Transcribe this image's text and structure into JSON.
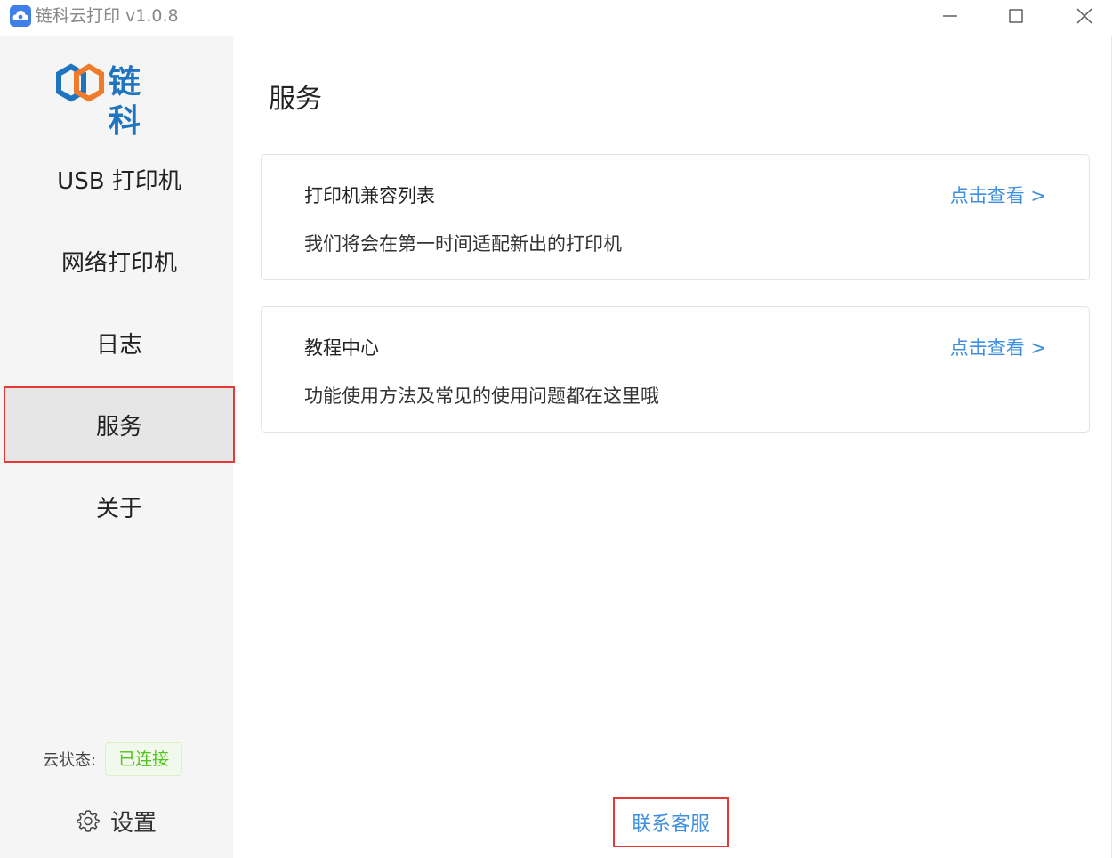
{
  "window": {
    "title": "链科云打印 v1.0.8"
  },
  "sidebar": {
    "logo_text": "链科",
    "items": [
      {
        "label": "USB 打印机"
      },
      {
        "label": "网络打印机"
      },
      {
        "label": "日志"
      },
      {
        "label": "服务",
        "active": true
      },
      {
        "label": "关于"
      }
    ],
    "cloud_status_label": "云状态:",
    "cloud_status_value": "已连接",
    "settings_label": "设置"
  },
  "main": {
    "title": "服务",
    "cards": [
      {
        "title": "打印机兼容列表",
        "description": "我们将会在第一时间适配新出的打印机",
        "link": "点击查看 >"
      },
      {
        "title": "教程中心",
        "description": "功能使用方法及常见的使用问题都在这里哦",
        "link": "点击查看 >"
      }
    ],
    "contact_label": "联系客服"
  },
  "colors": {
    "accent": "#3f8fe0",
    "logo": "#1f74c0",
    "success": "#52c41a",
    "highlight": "#e53935"
  }
}
